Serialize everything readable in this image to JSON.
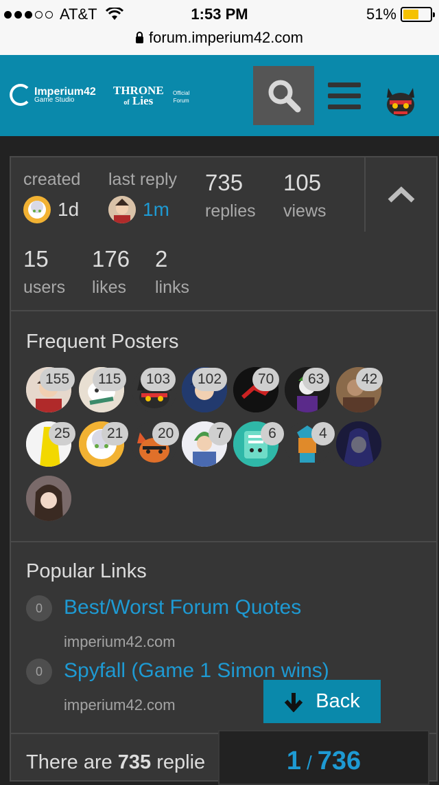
{
  "status_bar": {
    "carrier": "AT&T",
    "time": "1:53 PM",
    "battery": "51%"
  },
  "browser": {
    "url": "forum.imperium42.com"
  },
  "header": {
    "logo_imperium": {
      "name": "Imperium42",
      "sub": "Game Studio"
    },
    "logo_throne": {
      "line1": "THRONE",
      "line2": "of",
      "line3": "Lies"
    },
    "logo_official": {
      "line1": "Official",
      "line2": "Forum"
    }
  },
  "topic_stats": {
    "created_label": "created",
    "created_value": "1d",
    "last_reply_label": "last reply",
    "last_reply_value": "1m",
    "replies_value": "735",
    "replies_label": "replies",
    "views_value": "105",
    "views_label": "views",
    "users_value": "15",
    "users_label": "users",
    "likes_value": "176",
    "likes_label": "likes",
    "links_value": "2",
    "links_label": "links"
  },
  "frequent_posters": {
    "title": "Frequent Posters",
    "counts": [
      "155",
      "115",
      "103",
      "102",
      "70",
      "63",
      "42",
      "25",
      "21",
      "20",
      "7",
      "6",
      "4"
    ]
  },
  "popular_links": {
    "title": "Popular Links",
    "items": [
      {
        "count": "0",
        "title": "Best/Worst Forum Quotes",
        "domain": "imperium42.com"
      },
      {
        "count": "0",
        "title": "Spyfall (Game 1 Simon wins)",
        "domain": "imperium42.com"
      }
    ]
  },
  "summary": {
    "prefix": "There are",
    "count": "735",
    "suffix": "replie"
  },
  "back_button": {
    "label": "Back"
  },
  "progress": {
    "current": "1",
    "total": "736"
  },
  "colors": {
    "header_bg": "#0a89ab",
    "link": "#1e9ad3",
    "card_bg": "#363636"
  }
}
